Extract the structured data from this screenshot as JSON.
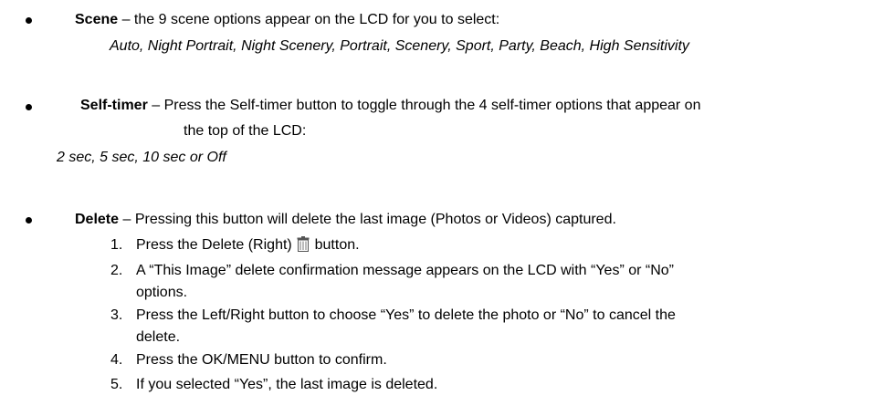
{
  "scene": {
    "term": "Scene",
    "description": " – the 9 scene options appear on the LCD for you to select:",
    "options": "Auto, Night Portrait, Night Scenery, Portrait, Scenery, Sport, Party, Beach, High Sensitivity"
  },
  "self_timer": {
    "term": "Self-timer",
    "description_line1": " – Press the Self-timer button to toggle through the 4 self-timer options that appear on",
    "description_line2": "the top of the LCD:",
    "options": "2 sec, 5 sec, 10 sec or Off"
  },
  "delete": {
    "term": "Delete",
    "description": " – Pressing this button will delete the last image (Photos or Videos) captured.",
    "steps": [
      {
        "num": "1.",
        "pre": "Press the Delete (Right) ",
        "icon": "trash-icon",
        "post": " button."
      },
      {
        "num": "2.",
        "line1": "A “This Image” delete confirmation message appears on the LCD with “Yes” or “No”",
        "line2": "options."
      },
      {
        "num": "3.",
        "line1": "Press the Left/Right button to choose “Yes” to delete the photo or “No” to cancel the",
        "line2": "delete."
      },
      {
        "num": "4.",
        "line1": "Press the OK/MENU button to confirm."
      },
      {
        "num": "5.",
        "line1": "If you selected “Yes”, the last image is deleted."
      }
    ]
  }
}
